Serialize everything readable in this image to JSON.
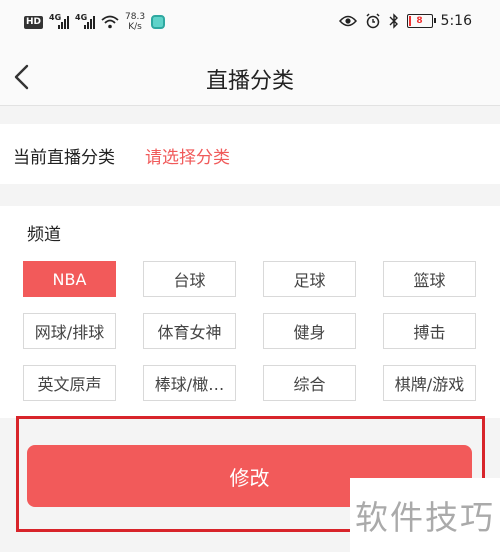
{
  "status_bar": {
    "hd": "HD",
    "net1": "4G",
    "net2": "4G",
    "speed_value": "78.3",
    "speed_unit": "K/s",
    "battery": "8",
    "battery_level": 0.08,
    "time": "5:16",
    "icons": [
      "eye-icon",
      "alarm-icon",
      "bluetooth-icon",
      "battery-icon"
    ]
  },
  "nav": {
    "title": "直播分类",
    "back_icon": "chevron-left-icon"
  },
  "current": {
    "label": "当前直播分类",
    "value": "请选择分类",
    "value_color": "#f05a5a"
  },
  "channels": {
    "title": "频道",
    "items": [
      {
        "label": "NBA",
        "selected": true
      },
      {
        "label": "台球",
        "selected": false
      },
      {
        "label": "足球",
        "selected": false
      },
      {
        "label": "篮球",
        "selected": false
      },
      {
        "label": "网球/排球",
        "selected": false
      },
      {
        "label": "体育女神",
        "selected": false
      },
      {
        "label": "健身",
        "selected": false
      },
      {
        "label": "搏击",
        "selected": false
      },
      {
        "label": "英文原声",
        "selected": false
      },
      {
        "label": "棒球/橄…",
        "selected": false
      },
      {
        "label": "综合",
        "selected": false
      },
      {
        "label": "棋牌/游戏",
        "selected": false
      }
    ]
  },
  "action": {
    "label": "修改"
  },
  "colors": {
    "accent": "#f25a5a",
    "highlight_border": "#d8242a"
  },
  "watermark": {
    "text": "软件技巧"
  }
}
